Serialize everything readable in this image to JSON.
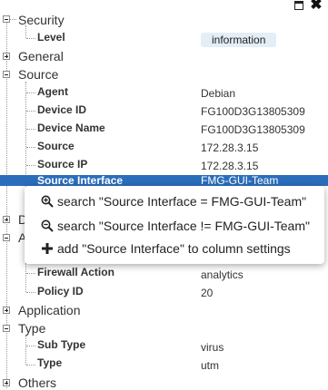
{
  "window": {
    "maximize_icon": "maximize-icon",
    "close_icon": "close-icon",
    "close_glyph": "✖"
  },
  "tree": {
    "security": {
      "label": "Security",
      "fields": [
        {
          "label": "Level",
          "value": "information"
        }
      ]
    },
    "general": {
      "label": "General"
    },
    "source": {
      "label": "Source",
      "fields": [
        {
          "label": "Agent",
          "value": "Debian"
        },
        {
          "label": "Device ID",
          "value": "FG100D3G13805309"
        },
        {
          "label": "Device Name",
          "value": "FG100D3G13805309"
        },
        {
          "label": "Source",
          "value": "172.28.3.15"
        },
        {
          "label": "Source IP",
          "value": "172.28.3.15"
        },
        {
          "label": "Source Interface",
          "value": "FMG-GUI-Team"
        }
      ]
    },
    "partial": {
      "d_label": "D",
      "a_label": "A"
    },
    "action_fields": [
      {
        "label": "Firewall Action",
        "value": "analytics"
      },
      {
        "label": "Policy ID",
        "value": "20"
      }
    ],
    "application": {
      "label": "Application"
    },
    "type": {
      "label": "Type",
      "fields": [
        {
          "label": "Sub Type",
          "value": "virus"
        },
        {
          "label": "Type",
          "value": "utm"
        }
      ]
    },
    "others": {
      "label": "Others"
    }
  },
  "context_menu": {
    "items": [
      {
        "icon": "zoom-in-icon",
        "label": "search \"Source Interface = FMG-GUI-Team\""
      },
      {
        "icon": "zoom-out-icon",
        "label": "search \"Source Interface != FMG-GUI-Team\""
      },
      {
        "icon": "plus-icon",
        "label": "add \"Source Interface\" to column settings"
      }
    ]
  }
}
